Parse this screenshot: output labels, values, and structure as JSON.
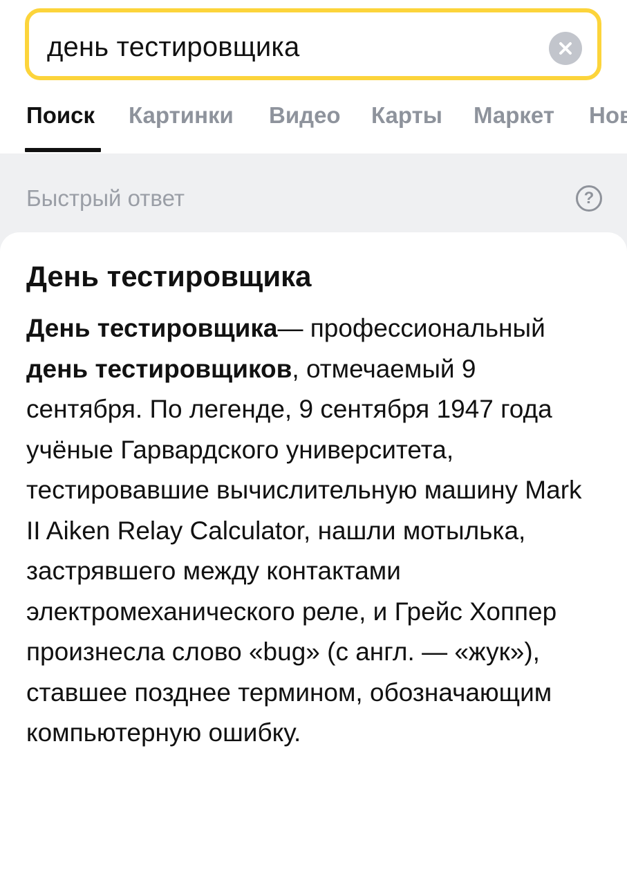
{
  "search": {
    "query": "день тестировщика"
  },
  "tabs": [
    {
      "label": "Поиск",
      "active": true
    },
    {
      "label": "Картинки",
      "active": false
    },
    {
      "label": "Видео",
      "active": false
    },
    {
      "label": "Карты",
      "active": false
    },
    {
      "label": "Маркет",
      "active": false
    },
    {
      "label": "Новости",
      "active": false
    }
  ],
  "quick_answer": {
    "label": "Быстрый ответ",
    "help_glyph": "?"
  },
  "card": {
    "title": "День тестировщика",
    "lead_bold": "День тестировщика",
    "dash": "—",
    "p1": " профессиональный ",
    "bold2": "день тестировщиков",
    "p2": ", отмечаемый 9 сентября. По легенде, 9 сентября 1947 года учёные Гарвардского университета, тестировавшие вычислительную машину Mark II Aiken Relay Calculator, нашли мотылька, застрявшего между контактами электромеханического реле, и Грейс Хоппер произнесла слово «bug» (с англ. — «жук»), ставшее позднее термином, обозначающим компьютерную ошибку."
  },
  "colors": {
    "search_border": "#fcd43b",
    "strip_bg": "#eff0f2",
    "tab_inactive": "#8e939c",
    "text": "#111111"
  },
  "icons": {
    "clear": "close-icon",
    "help": "question-icon"
  }
}
